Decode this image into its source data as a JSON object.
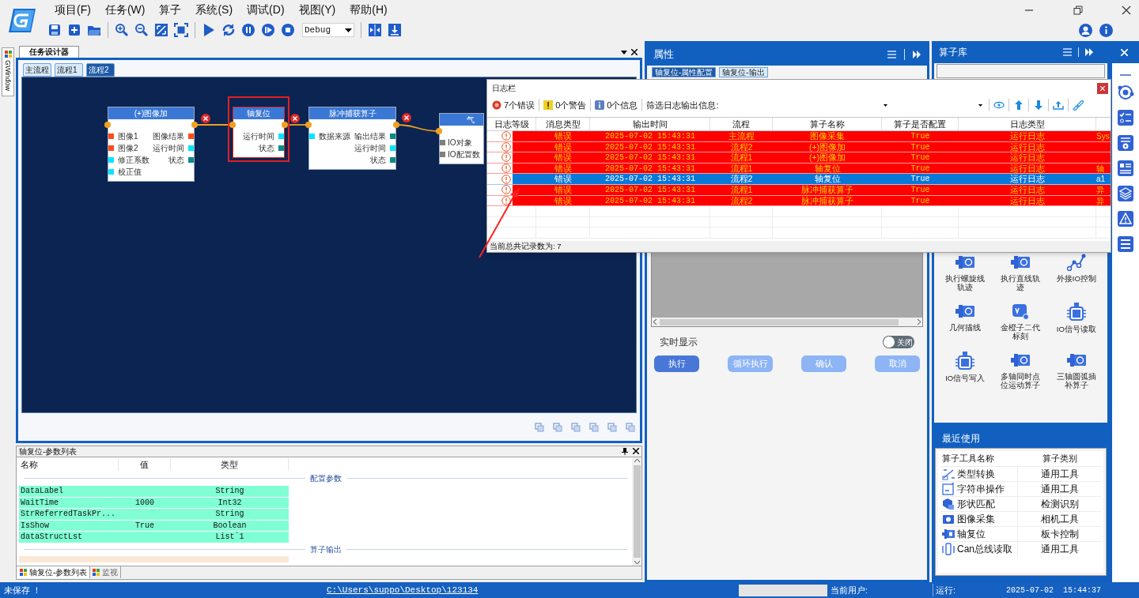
{
  "app": {
    "menu": [
      "项目(F)",
      "任务(W)",
      "算子",
      "系统(S)",
      "调试(D)",
      "视图(Y)",
      "帮助(H)"
    ],
    "build_config": "Debug"
  },
  "side_tab": "GWindow",
  "designer": {
    "tab": "任务设计器",
    "flow_tabs": [
      {
        "label": "主流程",
        "selected": false
      },
      {
        "label": "流程1",
        "selected": false
      },
      {
        "label": "流程2",
        "selected": true
      }
    ],
    "nodes": [
      {
        "title": "(+)图像加",
        "selected": false,
        "error": true,
        "inputs": [
          {
            "label": "图像1",
            "color": "#ff4a1a"
          },
          {
            "label": "图像2",
            "color": "#ff4a1a"
          },
          {
            "label": "修正系数",
            "color": "#00e5ff"
          },
          {
            "label": "校正值",
            "color": "#00e5ff"
          }
        ],
        "outputs": [
          {
            "label": "图像结果",
            "color": "#ff4a1a"
          },
          {
            "label": "运行时间",
            "color": "#00e5ff"
          },
          {
            "label": "状态",
            "color": "#0a8a8a"
          }
        ]
      },
      {
        "title": "轴复位",
        "selected": true,
        "error": true,
        "outputs": [
          {
            "label": "运行时间",
            "color": "#00e5ff"
          },
          {
            "label": "状态",
            "color": "#0a8a8a"
          }
        ]
      },
      {
        "title": "脉冲捕获算子",
        "selected": false,
        "error": true,
        "inputs": [
          {
            "label": "数据来源",
            "color": "#00e5ff"
          }
        ],
        "outputs": [
          {
            "label": "输出结果",
            "color": "#0a8a8a"
          },
          {
            "label": "运行时间",
            "color": "#00e5ff"
          },
          {
            "label": "状态",
            "color": "#0a8a8a"
          }
        ]
      },
      {
        "title": "气",
        "selected": false,
        "inputs": [
          {
            "label": "IO对象",
            "color": "#808080"
          },
          {
            "label": "IO配置数",
            "color": "#808080"
          }
        ]
      }
    ]
  },
  "params": {
    "title": "轴复位-参数列表",
    "columns": [
      "名称",
      "值",
      "类型"
    ],
    "groups": [
      {
        "title": "配置参数",
        "rows": [
          {
            "name": "DataLabel",
            "value": "",
            "type": "String"
          },
          {
            "name": "WaitTime",
            "value": "1000",
            "type": "Int32"
          },
          {
            "name": "StrReferredTaskPr...",
            "value": "",
            "type": "String"
          },
          {
            "name": "IsShow",
            "value": "True",
            "type": "Boolean"
          },
          {
            "name": "dataStructLst",
            "value": "",
            "type": "List`1"
          }
        ]
      },
      {
        "title": "算子输出"
      }
    ],
    "tabs": [
      {
        "label": "轴复位-参数列表",
        "selected": true
      },
      {
        "label": "监视",
        "selected": false
      }
    ]
  },
  "properties": {
    "title": "属性",
    "tabs": [
      {
        "label": "轴复位-属性配置",
        "selected": true
      },
      {
        "label": "轴复位-输出",
        "selected": false
      }
    ],
    "realtime_label": "实时显示",
    "toggle": {
      "label": "关闭",
      "on": false
    },
    "buttons": [
      {
        "label": "执行",
        "disabled": false
      },
      {
        "label": "循环执行",
        "disabled": true
      },
      {
        "label": "确认",
        "disabled": true
      },
      {
        "label": "取消",
        "disabled": true
      }
    ]
  },
  "library": {
    "title": "算子库",
    "tools": [
      {
        "label": "执行螺旋线轨迹",
        "kind": "motor"
      },
      {
        "label": "执行直线轨迹",
        "kind": "motor"
      },
      {
        "label": "外接IO控制",
        "kind": "graph"
      },
      {
        "label": "几何描线",
        "kind": "motor"
      },
      {
        "label": "金橙子二代标刻",
        "kind": "var"
      },
      {
        "label": "IO信号读取",
        "kind": "io"
      },
      {
        "label": "IO信号写入",
        "kind": "io"
      },
      {
        "label": "多轴同时点位运动算子",
        "kind": "motor"
      },
      {
        "label": "三轴圆弧插补算子",
        "kind": "motor"
      }
    ],
    "recent": {
      "title": "最近使用",
      "columns": [
        "算子工具名称",
        "算子类别"
      ],
      "rows": [
        {
          "name": "类型转换",
          "category": "通用工具",
          "kind": "convert"
        },
        {
          "name": "字符串操作",
          "category": "通用工具",
          "kind": "string"
        },
        {
          "name": "形状匹配",
          "category": "检测识别",
          "kind": "shape"
        },
        {
          "name": "图像采集",
          "category": "相机工具",
          "kind": "camera"
        },
        {
          "name": "轴复位",
          "category": "板卡控制",
          "kind": "motor"
        },
        {
          "name": "Can总线读取",
          "category": "通用工具",
          "kind": "can"
        }
      ]
    }
  },
  "log": {
    "title": "日志栏",
    "counts": [
      {
        "kind": "error",
        "label": "7个错误"
      },
      {
        "kind": "warning",
        "label": "0个警告"
      },
      {
        "kind": "info",
        "label": "0个信息"
      }
    ],
    "filter_label": "筛选日志输出信息:",
    "columns": [
      "日志等级",
      "消息类型",
      "输出时间",
      "流程",
      "算子名称",
      "算子是否配置",
      "日志类型"
    ],
    "rows": [
      {
        "type": "错误",
        "time": "2025-07-02 15:43:31",
        "flow": "主流程",
        "operator": "图像采集",
        "configured": "True",
        "log_type": "运行日志",
        "column_8": "Sys",
        "selected": false
      },
      {
        "type": "错误",
        "time": "2025-07-02 15:43:31",
        "flow": "流程2",
        "operator": "(+)图像加",
        "configured": "True",
        "log_type": "运行日志",
        "selected": false
      },
      {
        "type": "错误",
        "time": "2025-07-02 15:43:31",
        "flow": "流程1",
        "operator": "(+)图像加",
        "configured": "True",
        "log_type": "运行日志",
        "selected": false
      },
      {
        "type": "错误",
        "time": "2025-07-02 15:43:31",
        "flow": "流程1",
        "operator": "轴复位",
        "configured": "True",
        "log_type": "运行日志",
        "column_8": "轴",
        "selected": false
      },
      {
        "type": "错误",
        "time": "2025-07-02 15:43:31",
        "flow": "流程2",
        "operator": "轴复位",
        "configured": "True",
        "log_type": "运行日志",
        "column_8": "a1",
        "selected": true
      },
      {
        "type": "错误",
        "time": "2025-07-02 15:43:31",
        "flow": "流程1",
        "operator": "脉冲捕获算子",
        "configured": "True",
        "log_type": "运行日志",
        "column_8": "异",
        "selected": false
      },
      {
        "type": "错误",
        "time": "2025-07-02 15:43:31",
        "flow": "流程2",
        "operator": "脉冲捕获算子",
        "configured": "True",
        "log_type": "运行日志",
        "column_8": "异",
        "selected": false
      }
    ],
    "footer": "当前总共记录数为: 7"
  },
  "status_bar": {
    "save_state": "未保存 ！",
    "path": "C:\\Users\\suppo\\Desktop\\123134",
    "user_label": "当前用户:",
    "run_label": "运行:",
    "date": "2025-07-02",
    "time": "15:44:37"
  }
}
